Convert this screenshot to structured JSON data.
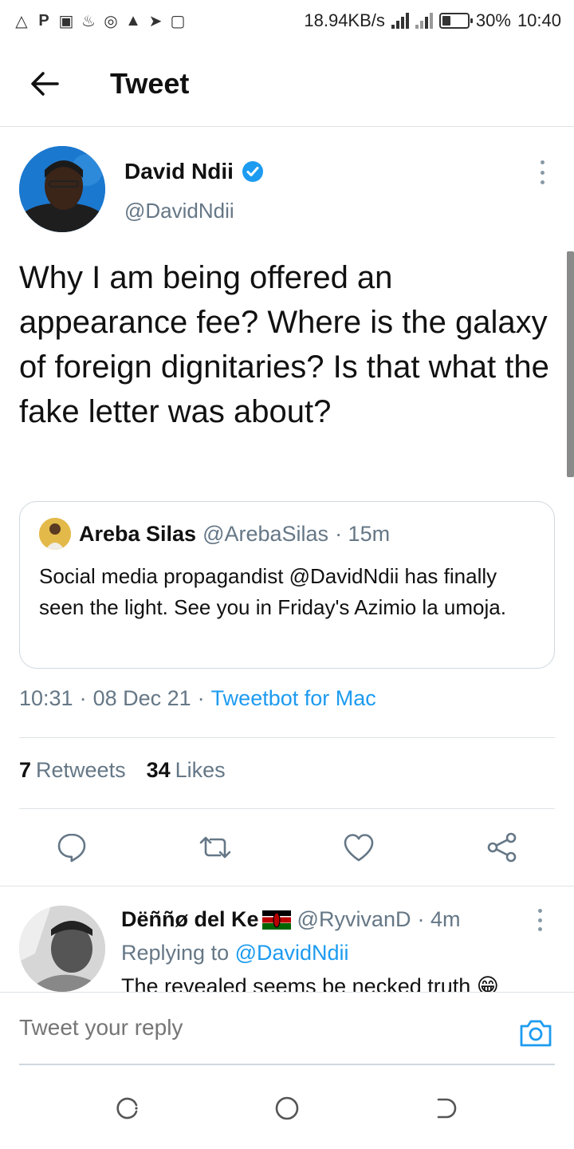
{
  "status_bar": {
    "net_speed": "18.94KB/s",
    "battery": "30%",
    "battery_level": 0.3,
    "time": "10:40",
    "left_icons": [
      "a",
      "P",
      "doc",
      "fire",
      "chrome",
      "warning",
      "send",
      "image"
    ]
  },
  "header": {
    "title": "Tweet"
  },
  "tweet": {
    "author_name": "David Ndii",
    "author_handle": "@DavidNdii",
    "verified": true,
    "text": "Why I am being offered an appearance fee? Where is the galaxy of foreign dignitaries? Is that what the fake letter was about?",
    "quote": {
      "name": "Areba Silas",
      "handle": "@ArebaSilas",
      "time": "· 15m",
      "text": "Social media propagandist @DavidNdii has finally seen the light. See you in Friday's Azimio la umoja."
    },
    "time": "10:31",
    "sep1": "·",
    "date": "08 Dec 21",
    "sep2": "·",
    "source": "Tweetbot for Mac",
    "retweets_count": "7",
    "retweets_label": "Retweets",
    "likes_count": "34",
    "likes_label": "Likes"
  },
  "reply": {
    "name": "Dëññø del Ke",
    "handle": "@RyvivanD",
    "time": "· 4m",
    "replying_prefix": "Replying to",
    "replying_to": "@DavidNdii",
    "text": "The revealed seems be necked truth 😁"
  },
  "composer": {
    "placeholder": "Tweet your reply"
  },
  "colors": {
    "accent": "#1d9bf0",
    "muted": "#657786",
    "text": "#0f1419"
  }
}
